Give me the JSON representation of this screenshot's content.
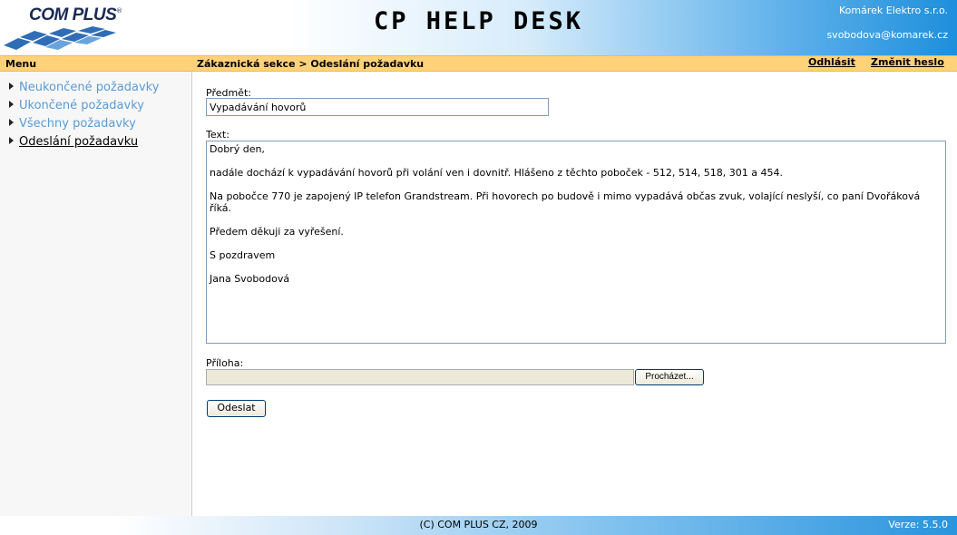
{
  "header": {
    "logo_text": "COM PLUS",
    "logo_reg": "®",
    "title": "CP HELP DESK",
    "company": "Komárek Elektro s.r.o.",
    "user_email": "svobodova@komarek.cz"
  },
  "bar": {
    "menu_title": "Menu",
    "breadcrumb": "Zákaznická sekce > Odeslání požadavku",
    "logout": "Odhlásit",
    "change_password": "Změnit heslo"
  },
  "sidebar": {
    "items": [
      {
        "label": "Neukončené požadavky"
      },
      {
        "label": "Ukončené požadavky"
      },
      {
        "label": "Všechny požadavky"
      },
      {
        "label": "Odeslání požadavku"
      }
    ]
  },
  "form": {
    "subject_label": "Předmět:",
    "subject_value": "Vypadávání hovorů",
    "text_label": "Text:",
    "text_value": "Dobrý den,\n\nnadále dochází k vypadávání hovorů při volání ven i dovnitř. Hlášeno z těchto poboček - 512, 514, 518, 301 a 454.\n\nNa pobočce 770 je zapojený IP telefon Grandstream. Při hovorech po budově i mimo vypadává občas zvuk, volající neslyší, co paní Dvořáková říká.\n\nPředem děkuji za vyřešení.\n\nS pozdravem\n\nJana Svobodová",
    "attachment_label": "Příloha:",
    "browse_label": "Procházet...",
    "send_label": "Odeslat"
  },
  "footer": {
    "copyright": "(C) COM PLUS CZ, 2009",
    "version": "Verze: 5.5.0"
  }
}
